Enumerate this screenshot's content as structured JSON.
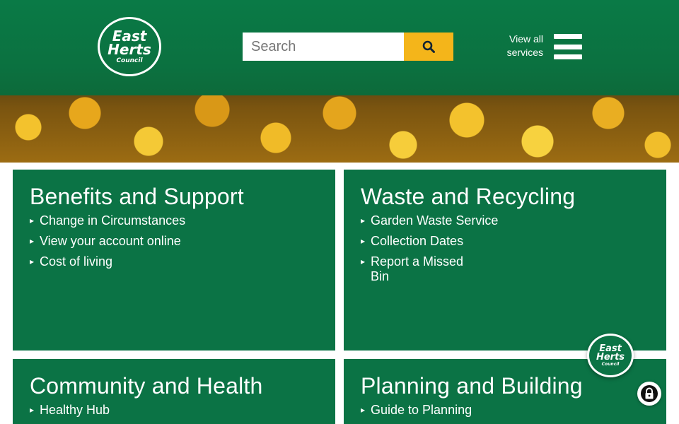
{
  "header": {
    "logo": {
      "line1": "East",
      "line2": "Herts",
      "line3": "Council"
    },
    "search": {
      "placeholder": "Search",
      "value": ""
    },
    "view_all_line1": "View all",
    "view_all_line2": "services"
  },
  "cards": [
    {
      "title": "Benefits and Support",
      "links": [
        "Change in Circumstances",
        "View your account online",
        "Cost of living"
      ]
    },
    {
      "title": "Waste and Recycling",
      "links": [
        "Garden Waste Service",
        "Collection Dates",
        "Report a Missed Bin"
      ]
    },
    {
      "title": "Community and Health",
      "links": [
        "Healthy Hub"
      ]
    },
    {
      "title": "Planning and Building",
      "links": [
        "Guide to Planning"
      ]
    }
  ],
  "chat_badge": {
    "line1": "East",
    "line2": "Herts",
    "line3": "Council"
  },
  "colors": {
    "brand_green": "#0b7345",
    "header_green": "#0a7a46",
    "search_button": "#f4b51a"
  },
  "icons": {
    "search": "search-icon",
    "menu": "hamburger-menu-icon",
    "link_arrow": "caret-right-icon",
    "lock": "lock-icon"
  }
}
